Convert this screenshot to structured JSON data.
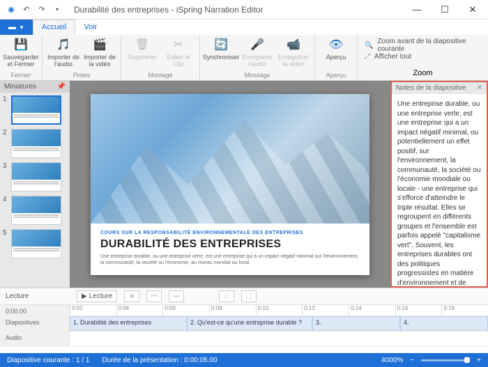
{
  "window": {
    "title": "Durabilité des entreprises - iSpring Narration Editor"
  },
  "tabs": {
    "file": "⬛",
    "home": "Accueil",
    "view": "Voir"
  },
  "ribbon": {
    "close": {
      "save": "Sauvegarder et Fermer",
      "label": "Fermer"
    },
    "tracks": {
      "importAudio": "Importer de l'audio",
      "importVideo": "Importer de la vidéo",
      "label": "Pistes"
    },
    "edit": {
      "delete": "Supprimer",
      "editClip": "Editer le Clip",
      "label": "Montage"
    },
    "timing": {
      "sync": "Synchroniser",
      "recAudio": "Enregistrer l'audio",
      "recVideo": "Enregistrer la vidéo",
      "label": "Minutage"
    },
    "preview": {
      "preview": "Aperçu",
      "label": "Aperçu"
    },
    "zoom": {
      "zoomCurrent": "Zoom avant de la diapositive courante",
      "showAll": "Afficher tout",
      "label": "Zoom"
    }
  },
  "panels": {
    "thumbs": "Miniatures",
    "notes": "Notes de la diapositive"
  },
  "thumbs": [
    {
      "n": "1"
    },
    {
      "n": "2"
    },
    {
      "n": "3"
    },
    {
      "n": "4"
    },
    {
      "n": "5"
    }
  ],
  "slide": {
    "kicker": "COURS SUR LA RESPONSABILITÉ ENVIRONNEMENTALE DES ENTREPRISES",
    "title": "DURABILITÉ DES ENTREPRISES",
    "para": "Une entreprise durable, ou une entreprise verte, est une entreprise qui a un impact négatif minimal sur l'environnement, la communauté, la société ou l'économie, au niveau mondial ou local."
  },
  "notes": "Une entreprise durable, ou une entreprise verte, est une entreprise qui a un impact négatif minimal, ou potentiellement un effet positif, sur l'environnement, la communauté, la société ou l'économie mondiale ou locale - une entreprise qui s'efforce d'atteindre le triple résultat. Elles se regroupent en différents groupes et l'ensemble est parfois appelé \"capitalisme vert\". Souvent, les entreprises durables ont des politiques progressistes en matière d'environnement et de droits de l'homme.",
  "playback": {
    "label": "Lecture",
    "play": "Lecture"
  },
  "timeline": {
    "start": "0:00.00",
    "ticks": [
      "0:02",
      "0:04",
      "0:06",
      "0:08",
      "0:10",
      "0:12",
      "0:14",
      "0:16",
      "0:18"
    ],
    "rowSlides": "Diapositives",
    "rowAudio": "Audio",
    "clips": [
      {
        "n": "1.",
        "t": "Durabilité des entreprises"
      },
      {
        "n": "2.",
        "t": "Qu'est-ce qu'une entreprise durable ?"
      },
      {
        "n": "3.",
        "t": ""
      },
      {
        "n": "4.",
        "t": ""
      }
    ]
  },
  "status": {
    "current": "Diapositive courante : 1 / 1",
    "duration": "Durée de la présentation : 0:00:05.00",
    "zoom": "4000%"
  }
}
